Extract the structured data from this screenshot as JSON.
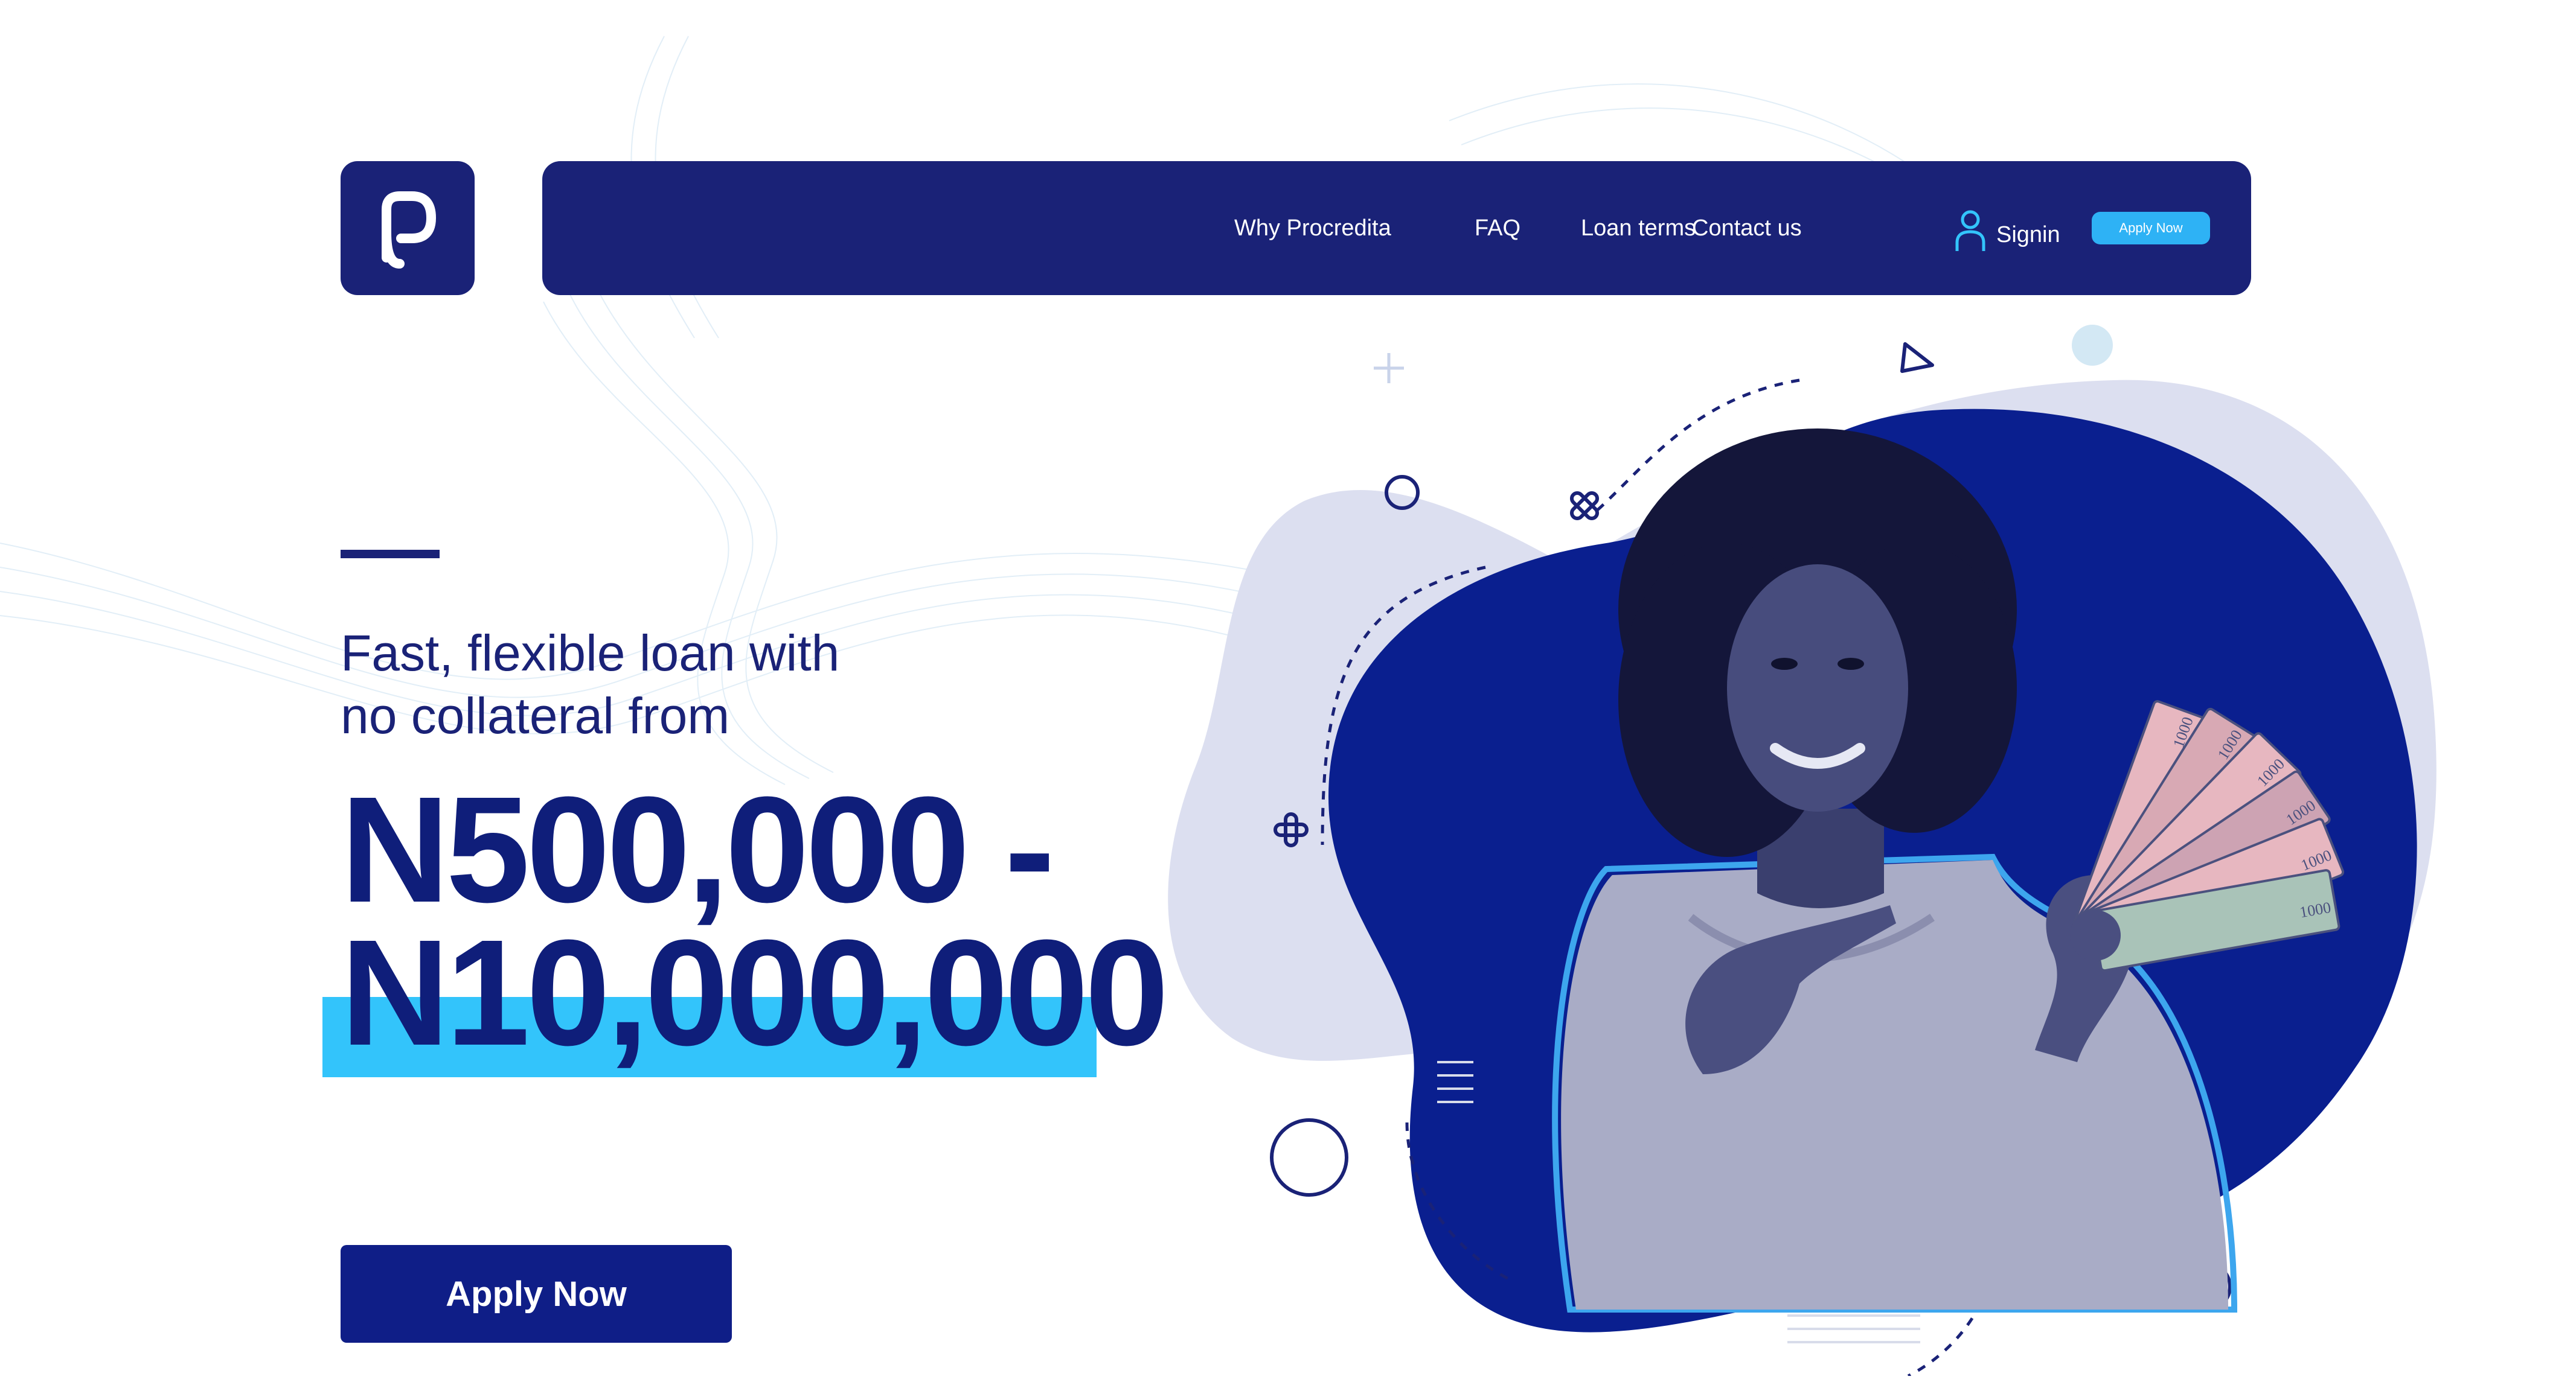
{
  "brand": {
    "logo_letter": "P",
    "color": "#1a2277"
  },
  "nav": {
    "items": [
      {
        "label": "Why Procredita"
      },
      {
        "label": "FAQ"
      },
      {
        "label": "Loan terms"
      },
      {
        "label": "Contact us"
      }
    ],
    "signin_label": "Signin",
    "apply_label": "Apply Now"
  },
  "hero": {
    "tagline_line1": "Fast, flexible loan with",
    "tagline_line2": "no collateral from",
    "amount_line1": "N500,000 -",
    "amount_line2": "N10,000,000",
    "cta_label": "Apply Now",
    "banknote_label": "1000"
  },
  "colors": {
    "navy": "#1a2277",
    "royal_blue": "#0a1f8f",
    "accent_cyan": "#33c4fb",
    "nav_button": "#2eb2f5",
    "lavender_blob": "#dcdff0"
  },
  "icons": [
    "user-icon",
    "logo-p-icon"
  ]
}
